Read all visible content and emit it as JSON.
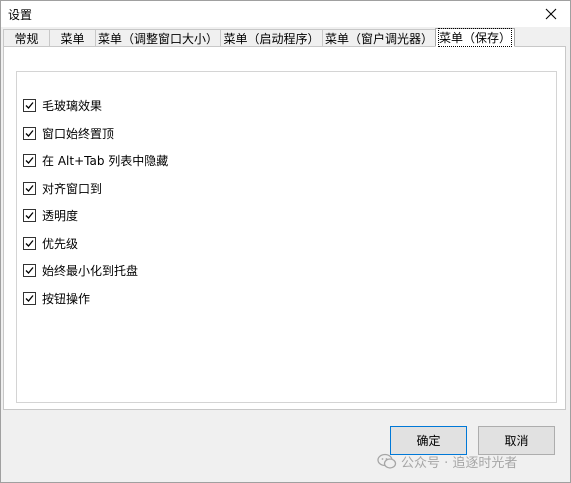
{
  "window": {
    "title": "设置"
  },
  "tabs": [
    {
      "label": "常规",
      "active": false
    },
    {
      "label": "菜单",
      "active": false
    },
    {
      "label": "菜单（调整窗口大小）",
      "active": false
    },
    {
      "label": "菜单（启动程序）",
      "active": false
    },
    {
      "label": "菜单（窗户调光器）",
      "active": false
    },
    {
      "label": "菜单（保存）",
      "active": true
    }
  ],
  "options": [
    {
      "label": "毛玻璃效果",
      "checked": true
    },
    {
      "label": "窗口始终置顶",
      "checked": true
    },
    {
      "label": "在 Alt+Tab 列表中隐藏",
      "checked": true
    },
    {
      "label": "对齐窗口到",
      "checked": true
    },
    {
      "label": "透明度",
      "checked": true
    },
    {
      "label": "优先级",
      "checked": true
    },
    {
      "label": "始终最小化到托盘",
      "checked": true
    },
    {
      "label": "按钮操作",
      "checked": true
    }
  ],
  "buttons": {
    "ok_label": "确定",
    "cancel_label": "取消"
  },
  "watermark": {
    "text": "公众号 · 追逐时光者",
    "icon": "wechat-icon"
  },
  "icons": {
    "close": "close-icon",
    "check": "check-icon"
  },
  "colors": {
    "ok_border": "#0078d7",
    "panel_bg": "#ffffff",
    "window_bg": "#f0f0f0"
  }
}
